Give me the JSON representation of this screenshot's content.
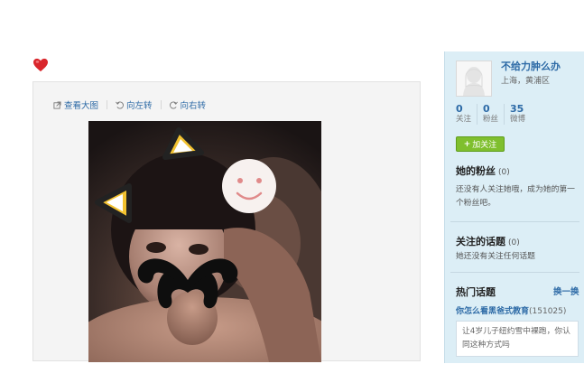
{
  "toolbar": {
    "view_large": "查看大图",
    "rotate_left": "向左转",
    "rotate_right": "向右转"
  },
  "profile": {
    "name": "不给力肿么办",
    "location": "上海，黄浦区",
    "stats": [
      {
        "value": "0",
        "label": "关注"
      },
      {
        "value": "0",
        "label": "粉丝"
      },
      {
        "value": "35",
        "label": "微博"
      }
    ],
    "follow_button": "加关注"
  },
  "fans": {
    "title": "她的粉丝",
    "count": "(0)",
    "text": "还没有人关注她哦，成为她的第一个粉丝吧。"
  },
  "topics_followed": {
    "title": "关注的话题",
    "count": "(0)",
    "text": "她还没有关注任何话题"
  },
  "hot_topics": {
    "title": "热门话题",
    "refresh": "换一换",
    "link": "你怎么看黑爸式教育",
    "link_count": "(151025)",
    "box_text": "让4岁儿子纽约雪中裸跑，你认同这种方式吗"
  },
  "colors": {
    "link_blue": "#2d6aa6",
    "sidebar_bg": "#dceef6",
    "follow_green": "#7fbf2e"
  }
}
